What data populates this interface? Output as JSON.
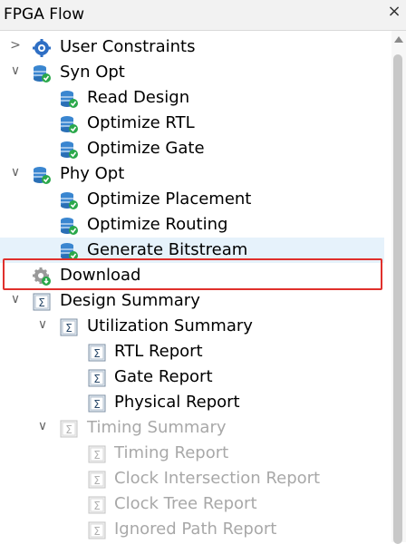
{
  "panel": {
    "title": "FPGA Flow",
    "close_glyph": "×"
  },
  "tree": [
    {
      "label": "User Constraints",
      "icon": "gear-icon",
      "expand": "collapsed",
      "disabled": false
    },
    {
      "label": "Syn Opt",
      "icon": "database-icon",
      "expand": "expanded",
      "disabled": false
    },
    {
      "label": "Read Design",
      "icon": "database-icon",
      "expand": "none",
      "disabled": false
    },
    {
      "label": "Optimize RTL",
      "icon": "database-icon",
      "expand": "none",
      "disabled": false
    },
    {
      "label": "Optimize Gate",
      "icon": "database-icon",
      "expand": "none",
      "disabled": false
    },
    {
      "label": "Phy Opt",
      "icon": "database-icon",
      "expand": "expanded",
      "disabled": false
    },
    {
      "label": "Optimize Placement",
      "icon": "database-icon",
      "expand": "none",
      "disabled": false
    },
    {
      "label": "Optimize Routing",
      "icon": "database-icon",
      "expand": "none",
      "disabled": false
    },
    {
      "label": "Generate Bitstream",
      "icon": "database-icon",
      "expand": "none",
      "disabled": false
    },
    {
      "label": "Download",
      "icon": "gear-download-icon",
      "expand": "none",
      "disabled": false
    },
    {
      "label": "Design Summary",
      "icon": "summary-icon",
      "expand": "expanded",
      "disabled": false
    },
    {
      "label": "Utilization Summary",
      "icon": "summary-icon",
      "expand": "expanded",
      "disabled": false
    },
    {
      "label": "RTL Report",
      "icon": "summary-icon",
      "expand": "none",
      "disabled": false
    },
    {
      "label": "Gate Report",
      "icon": "summary-icon",
      "expand": "none",
      "disabled": false
    },
    {
      "label": "Physical Report",
      "icon": "summary-icon",
      "expand": "none",
      "disabled": false
    },
    {
      "label": "Timing Summary",
      "icon": "summary-icon",
      "expand": "expanded",
      "disabled": true
    },
    {
      "label": "Timing Report",
      "icon": "summary-icon",
      "expand": "none",
      "disabled": true
    },
    {
      "label": "Clock Intersection Report",
      "icon": "summary-icon",
      "expand": "none",
      "disabled": true
    },
    {
      "label": "Clock Tree Report",
      "icon": "summary-icon",
      "expand": "none",
      "disabled": true
    },
    {
      "label": "Ignored Path Report",
      "icon": "summary-icon",
      "expand": "none",
      "disabled": true
    }
  ],
  "highlighted_item": "Generate Bitstream",
  "outlined_item": "Download",
  "colors": {
    "highlight": "#e6f2fb",
    "outline": "#e0302c",
    "disabled_text": "#a8a8a8"
  }
}
